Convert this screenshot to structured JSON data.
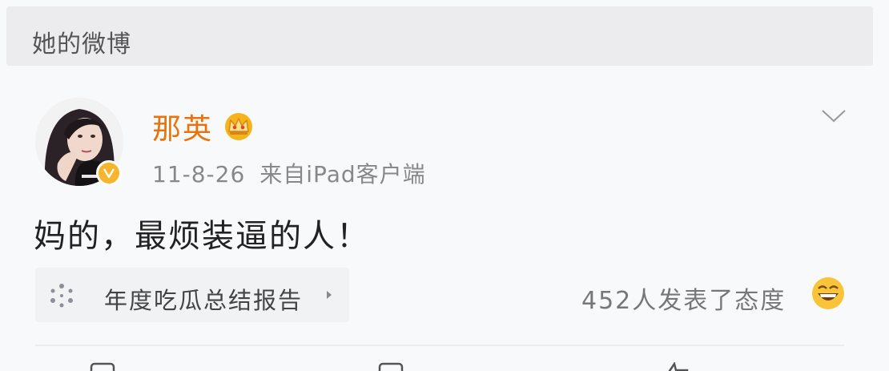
{
  "section": {
    "title": "她的微博"
  },
  "post": {
    "username": "那英",
    "date": "11-8-26",
    "source": "来自iPad客户端",
    "text": "妈的，最烦装逼的人！",
    "topic": {
      "label": "年度吃瓜总结报告",
      "icon": "sparkle-icon"
    },
    "reactions": {
      "text": "452人发表了态度",
      "icon": "grin-emoji-icon"
    }
  },
  "icons": {
    "badge": "verified-v-icon",
    "crown": "crown-icon",
    "menu": "chevron-down-icon"
  },
  "colors": {
    "username": "#e8730c",
    "badge": "#f6b52b",
    "header_bg": "#ececef"
  }
}
